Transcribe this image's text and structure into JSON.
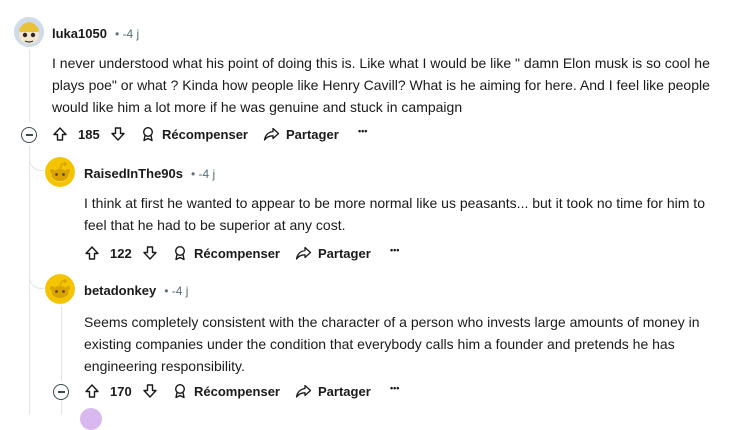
{
  "comments": [
    {
      "username": "luka1050",
      "time": "• -4 j",
      "body": "I never understood what his point of doing this is. Like what I would be like \" damn Elon musk is so cool he plays poe\" or what ? Kinda how people like Henry Cavill? What is he aiming for here. And I feel like people would like him a lot more if he was genuine and stuck in campaign",
      "votes": "185",
      "reward": "Récompenser",
      "share": "Partager",
      "more": "•••"
    },
    {
      "username": "RaisedInThe90s",
      "time": "• -4 j",
      "body": "I think at first he wanted to appear to be more normal like us peasants... but it took no time for him to feel that he had to be superior at any cost.",
      "votes": "122",
      "reward": "Récompenser",
      "share": "Partager",
      "more": "•••"
    },
    {
      "username": "betadonkey",
      "time": "• -4 j",
      "body": "Seems completely consistent with the character of a person who invests large amounts of money in existing companies under the condition that everybody calls him a founder and pretends he has engineering responsibility.",
      "votes": "170",
      "reward": "Récompenser",
      "share": "Partager",
      "more": "•••"
    }
  ],
  "colors": {
    "snoo_yellow": "#f5c400",
    "thread_line": "#e2e5e8",
    "meta": "#576f76"
  }
}
